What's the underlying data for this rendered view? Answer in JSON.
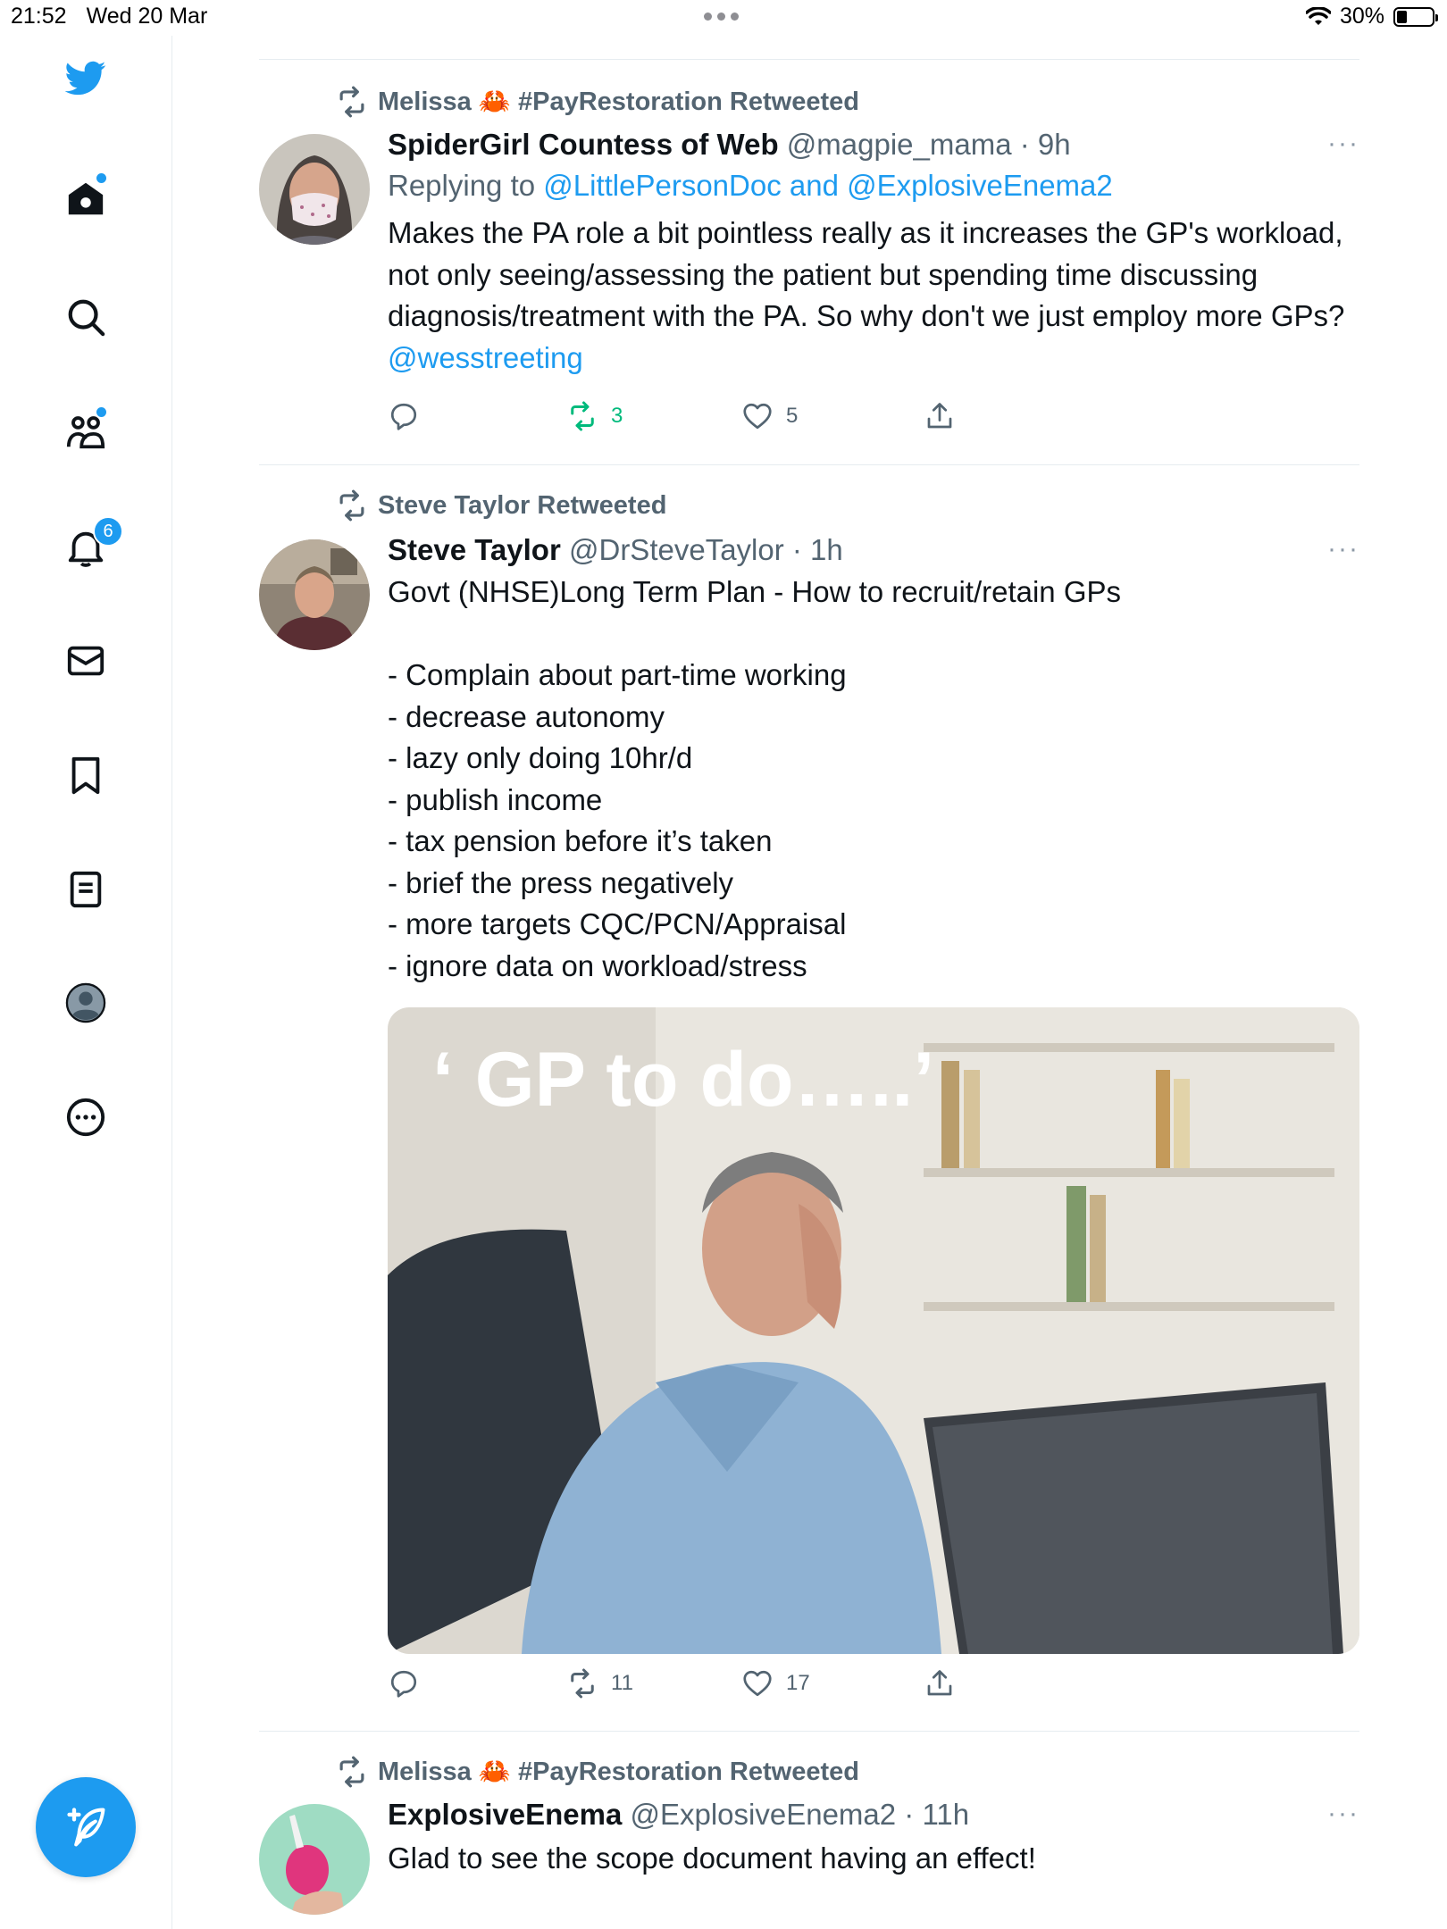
{
  "status_bar": {
    "time": "21:52",
    "date": "Wed 20 Mar",
    "battery": "30%",
    "battery_level": 0.3
  },
  "sidebar": {
    "notifications_badge": "6"
  },
  "tweets": [
    {
      "retweeted_by": "Melissa 🦀 #PayRestoration Retweeted",
      "name": "SpiderGirl Countess of Web",
      "handle": "@magpie_mama",
      "time": "· 9h",
      "replying_to_prefix": "Replying to ",
      "replying_to": "@LittlePersonDoc and @ExplosiveEnema2",
      "text": "Makes the PA role a bit pointless really as it increases the GP's workload, not only seeing/assessing the patient but spending time discussing diagnosis/treatment with the PA. So why don't we just employ more GPs? ",
      "text_link": "@wesstreeting",
      "retweets": "3",
      "likes": "5",
      "more": "···"
    },
    {
      "retweeted_by": "Steve Taylor Retweeted",
      "name": "Steve Taylor",
      "handle": "@DrSteveTaylor",
      "time": "· 1h",
      "text": "Govt (NHSE)Long Term Plan - How to recruit/retain GPs\n\n- Complain about part-time working\n- decrease autonomy\n- lazy only doing 10hr/d\n- publish income\n- tax pension before it’s taken\n- brief the press negatively\n- more targets CQC/PCN/Appraisal\n- ignore data on workload/stress",
      "image_caption": "‘ GP to do…..’",
      "retweets": "11",
      "likes": "17",
      "more": "···"
    },
    {
      "retweeted_by": "Melissa 🦀 #PayRestoration Retweeted",
      "name": "ExplosiveEnema",
      "handle": "@ExplosiveEnema2",
      "time": "· 11h",
      "text": "Glad to see the scope document having an effect!",
      "more": "···"
    }
  ],
  "colors": {
    "accent": "#1d9bf0",
    "retweet_green": "#00ba7c",
    "muted": "#536471"
  }
}
